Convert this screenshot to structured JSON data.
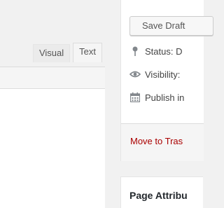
{
  "editor": {
    "tabs": [
      {
        "label": "Visual",
        "active": false
      },
      {
        "label": "Text",
        "active": true
      }
    ]
  },
  "publish": {
    "save_draft_label": "Save Draft",
    "status_label": "Status: D",
    "visibility_label": "Visibility:",
    "publish_label": "Publish in",
    "trash_label": "Move to Tras",
    "icons": {
      "status": "pin-icon",
      "visibility": "eye-icon",
      "publish": "calendar-icon"
    }
  },
  "page_attributes": {
    "title": "Page Attribu"
  },
  "colors": {
    "trash_link": "#aa0000",
    "icon": "#82878c",
    "background": "#f1f1f1"
  }
}
